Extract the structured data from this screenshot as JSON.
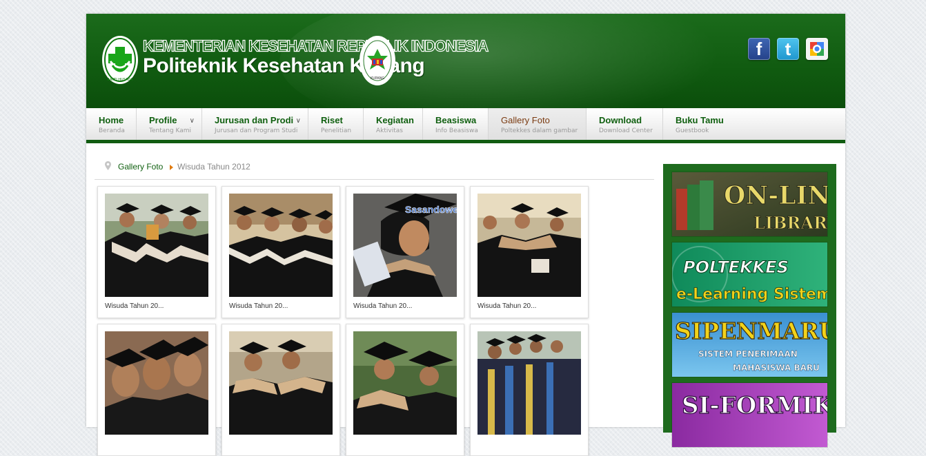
{
  "header": {
    "ministry": "KEMENTERIAN KESEHATAN REPUBLIK INDONESIA",
    "institution": "Politeknik Kesehatan Kupang",
    "logo_left_text": "BAKTI HUSADA",
    "logo_right_text": "KUPANG"
  },
  "social": [
    {
      "icon": "facebook-icon",
      "glyph": "f"
    },
    {
      "icon": "twitter-icon",
      "glyph": "t"
    },
    {
      "icon": "google-icon",
      "glyph": ""
    }
  ],
  "nav": [
    {
      "title": "Home",
      "sub": "Beranda"
    },
    {
      "title": "Profile",
      "sub": "Tentang Kami"
    },
    {
      "title": "Jurusan dan Prodi",
      "sub": "Jurusan dan Program Studi"
    },
    {
      "title": "Riset",
      "sub": "Penelitian"
    },
    {
      "title": "Kegiatan",
      "sub": "Aktivitas"
    },
    {
      "title": "Beasiswa",
      "sub": "Info Beasiswa"
    },
    {
      "title": "Gallery Foto",
      "sub": "Poltekkes dalam gambar"
    },
    {
      "title": "Download",
      "sub": "Download Center"
    },
    {
      "title": "Buku Tamu",
      "sub": "Guestbook"
    }
  ],
  "breadcrumb": {
    "section": "Gallery Foto",
    "current": "Wisuda Tahun 2012"
  },
  "gallery": [
    {
      "caption": "Wisuda Tahun 20..."
    },
    {
      "caption": "Wisuda Tahun 20..."
    },
    {
      "caption": "Wisuda Tahun 20..."
    },
    {
      "caption": "Wisuda Tahun 20..."
    },
    {
      "caption": ""
    },
    {
      "caption": ""
    },
    {
      "caption": ""
    },
    {
      "caption": ""
    }
  ],
  "watermark": "Sasandoweb",
  "sidebar": {
    "banners": [
      {
        "line1": "ON-LINE",
        "line2": "LIBRARY"
      },
      {
        "line1": "POLTEKKES",
        "line2": "e-Learning Sistem"
      },
      {
        "line1": "SIPENMARU",
        "line2": "SISTEM PENERIMAAN",
        "line3": "MAHASISWA BARU"
      },
      {
        "line1": "SI-FORMIK"
      }
    ]
  },
  "colors": {
    "brand_green": "#115c11",
    "accent_orange": "#e07b10",
    "active_nav": "#7a3a10"
  }
}
